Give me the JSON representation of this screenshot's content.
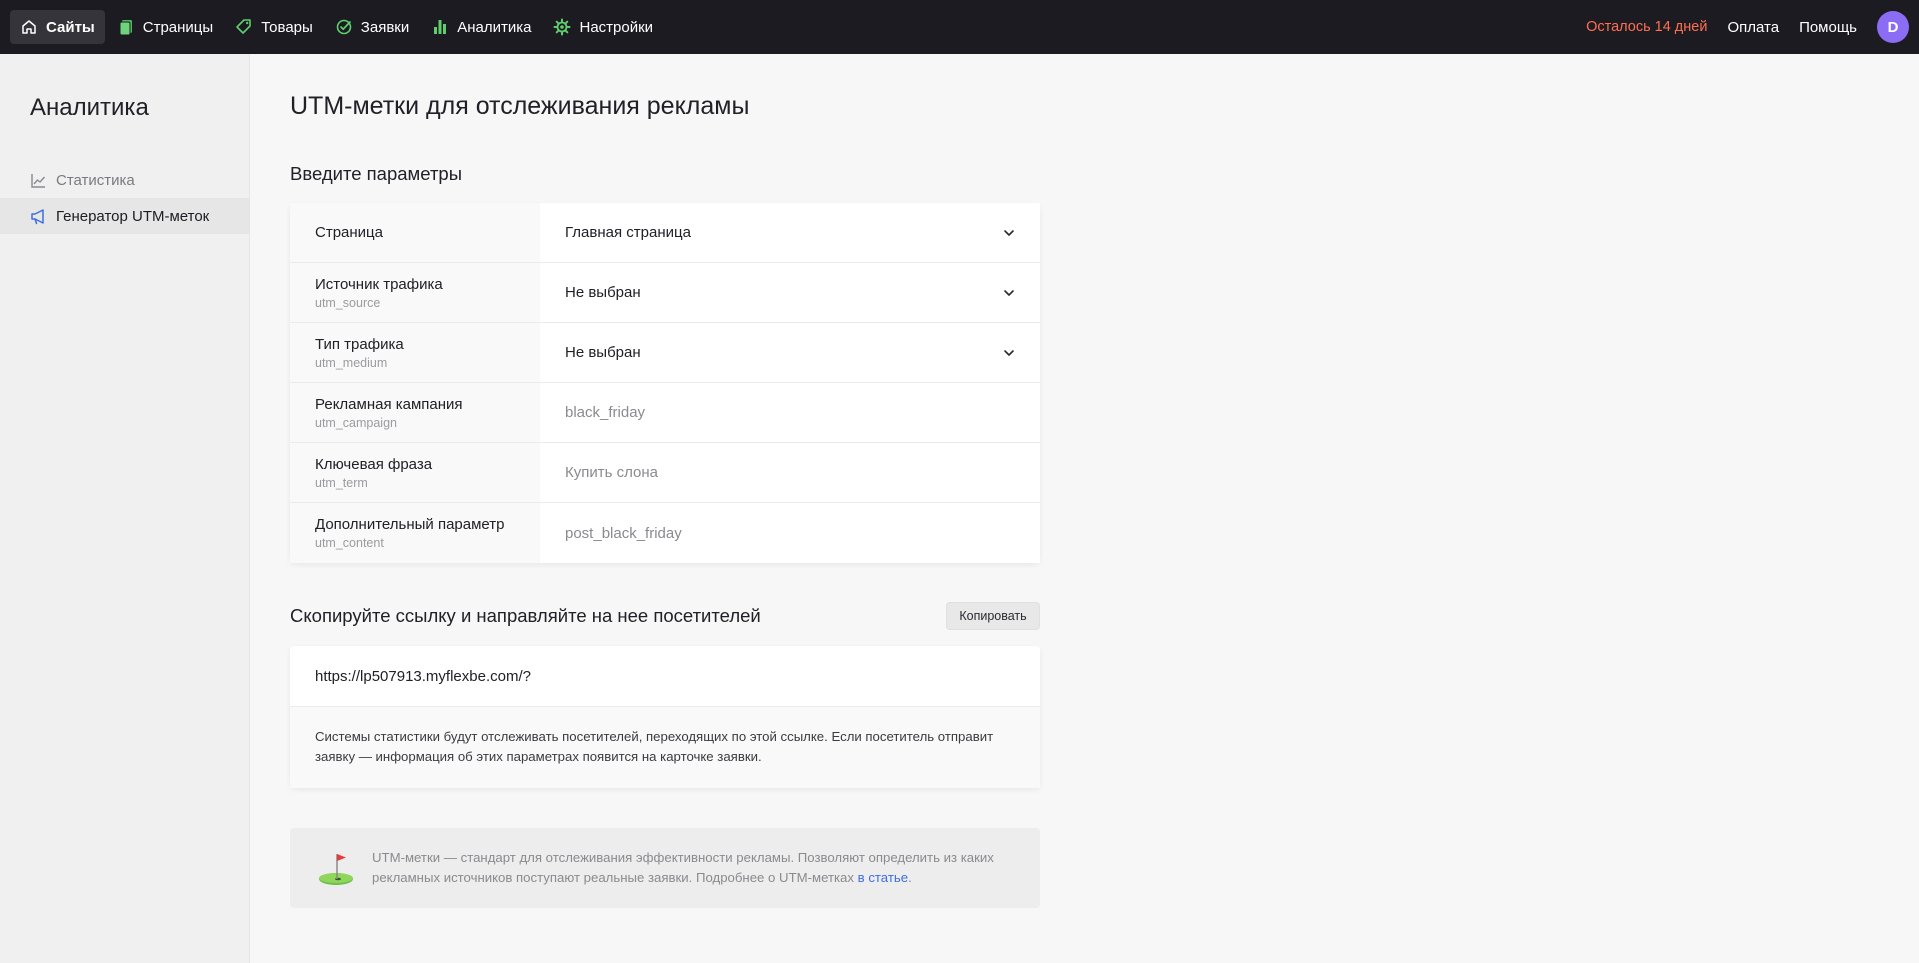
{
  "topbar": {
    "nav": [
      {
        "label": "Сайты",
        "icon": "home-icon",
        "active": true
      },
      {
        "label": "Страницы",
        "icon": "pages-icon"
      },
      {
        "label": "Товары",
        "icon": "tag-icon"
      },
      {
        "label": "Заявки",
        "icon": "check-circle-icon"
      },
      {
        "label": "Аналитика",
        "icon": "bar-chart-icon"
      },
      {
        "label": "Настройки",
        "icon": "gear-icon"
      }
    ],
    "trial": "Осталось 14 дней",
    "payment": "Оплата",
    "help": "Помощь",
    "avatar_letter": "D"
  },
  "sidebar": {
    "title": "Аналитика",
    "items": [
      {
        "label": "Статистика",
        "icon": "line-chart-icon"
      },
      {
        "label": "Генератор UTM-меток",
        "icon": "megaphone-icon",
        "active": true
      }
    ]
  },
  "main": {
    "title": "UTM-метки для отслеживания рекламы",
    "params_title": "Введите параметры",
    "rows": [
      {
        "label": "Страница",
        "sub": "",
        "value": "Главная страница",
        "type": "select"
      },
      {
        "label": "Источник трафика",
        "sub": "utm_source",
        "value": "Не выбран",
        "type": "select"
      },
      {
        "label": "Тип трафика",
        "sub": "utm_medium",
        "value": "Не выбран",
        "type": "select"
      },
      {
        "label": "Рекламная кампания",
        "sub": "utm_campaign",
        "placeholder": "black_friday",
        "type": "input"
      },
      {
        "label": "Ключевая фраза",
        "sub": "utm_term",
        "placeholder": "Купить слона",
        "type": "input"
      },
      {
        "label": "Дополнительный параметр",
        "sub": "utm_content",
        "placeholder": "post_black_friday",
        "type": "input"
      }
    ],
    "copy_title": "Скопируйте ссылку и направляйте на нее посетителей",
    "copy_button": "Копировать",
    "url": "https://lp507913.myflexbe.com/?",
    "note": "Системы статистики будут отслеживать посетителей, переходящих по этой ссылке. Если посетитель отправит заявку — информация об этих параметрах появится на карточке заявки.",
    "info_text": "UTM-метки — стандарт для отслеживания эффективности рекламы. Позволяют определить из каких рекламных источников поступают реальные заявки. Подробнее о UTM-метках ",
    "info_link": "в статье",
    "info_end": ".",
    "colors": {
      "accent": "#3d6fe0",
      "trial": "#ff6f52",
      "avatar": "#8b6cf5",
      "topbar": "#1c1b22"
    }
  }
}
